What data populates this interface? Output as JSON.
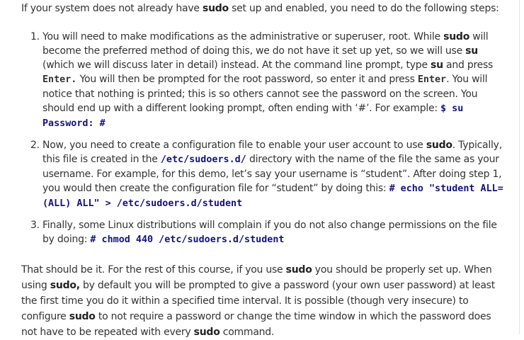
{
  "intro": {
    "t1": "If your system does not already have ",
    "b1": "sudo",
    "t2": " set up and enabled, you need to do the following steps:"
  },
  "steps": [
    {
      "t1": "You will need to make modifications as the administrative or superuser, root. While ",
      "b1": "sudo",
      "t2": " will become the preferred method of doing this, we do not have it set up yet, so we will use ",
      "b2": "su",
      "t3": " (which we will discuss later in detail) instead. At the command line prompt, type ",
      "b3": "su",
      "t4": " and press ",
      "c1": "Enter.",
      "t5": " You will then be prompted for the root password, so enter it and press ",
      "c2": "Enter",
      "t6": ". You will notice that nothing is printed; this is so others cannot see the password on the screen. You should end up with a different looking prompt, often ending with ‘#’. For example: ",
      "c3": "$ su Password: #"
    },
    {
      "t1": "Now, you need to create a configuration file to enable your user account to use ",
      "b1": "sudo",
      "t2": ". Typically, this file is created in the ",
      "c1": "/etc/sudoers.d/",
      "t3": " directory with the name of the file the same as your username. For example, for this demo, let’s say your username is “student”. After doing step 1, you would then create the configuration file for “student” by doing this: ",
      "c2": "# echo \"student ALL=(ALL) ALL\" > /etc/sudoers.d/student"
    },
    {
      "t1": "Finally, some Linux distributions will complain if you do not also change permissions on the file by doing: ",
      "c1": "# chmod 440 /etc/sudoers.d/student"
    }
  ],
  "outro": {
    "t1": "That should be it. For the rest of this course, if you use ",
    "b1": "sudo",
    "t2": " you should be properly set up. When using ",
    "b2": "sudo,",
    "t3": " by default you will be prompted to give a password (your own user password) at least the first time you do it within a specified time interval. It is possible (though very insecure) to configure ",
    "b3": "sudo",
    "t4": " to not require a password or change the time window in which the password does not have to be repeated with every ",
    "b4": "sudo",
    "t5": " command."
  }
}
